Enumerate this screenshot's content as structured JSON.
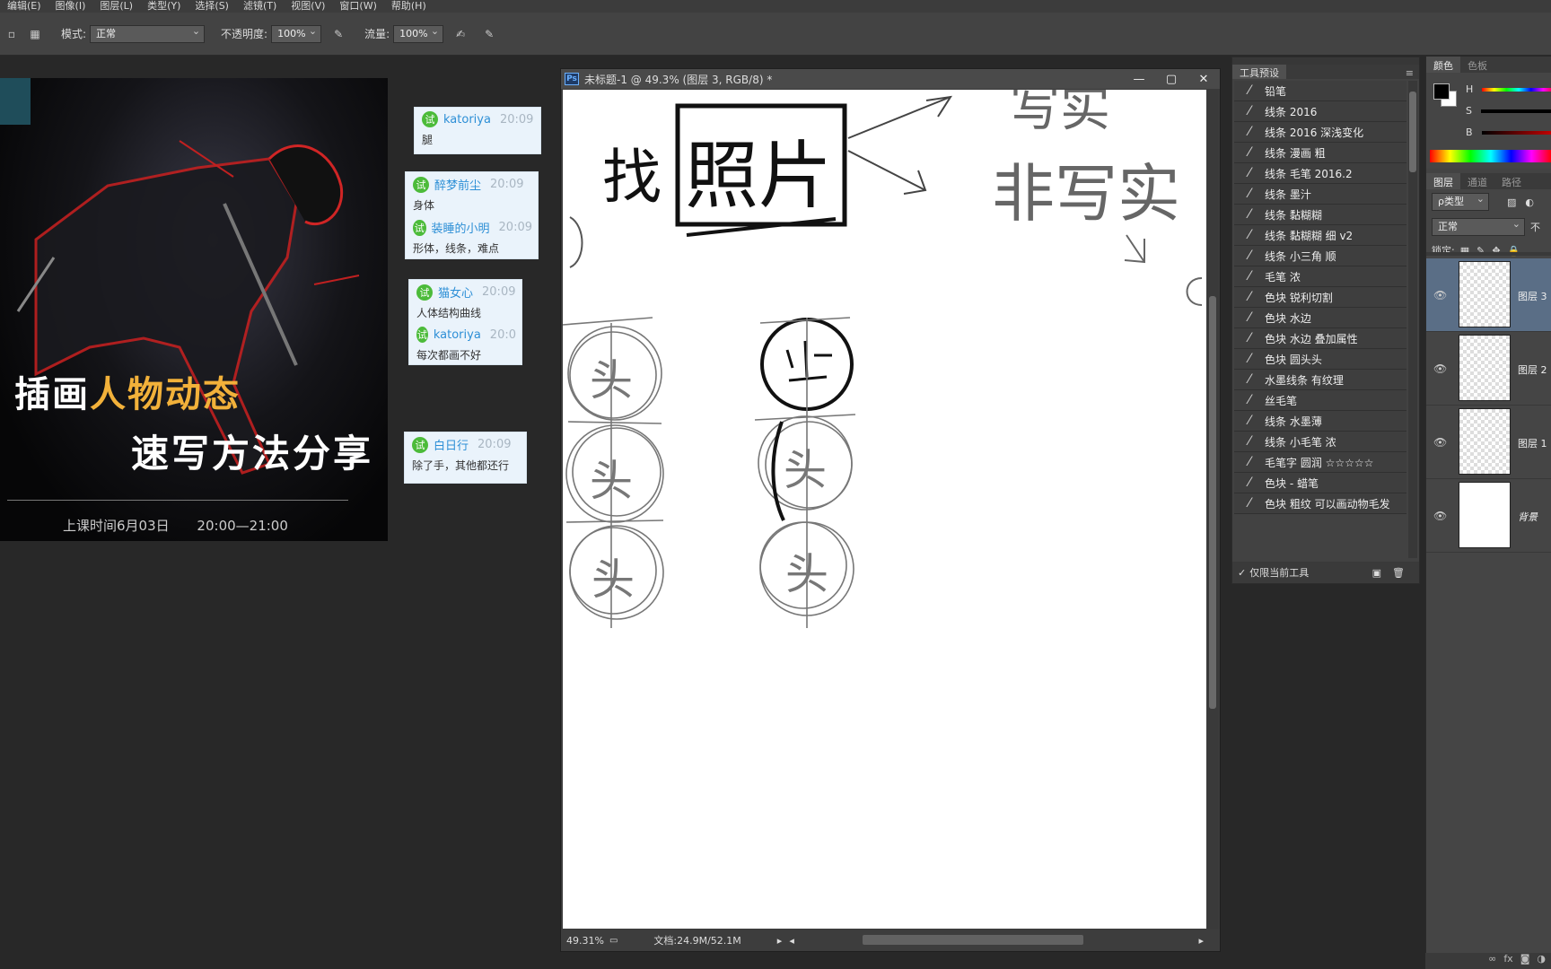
{
  "menu": [
    "编辑(E)",
    "图像(I)",
    "图层(L)",
    "类型(Y)",
    "选择(S)",
    "滤镜(T)",
    "视图(V)",
    "窗口(W)",
    "帮助(H)"
  ],
  "options": {
    "mode_label": "模式:",
    "mode_value": "正常",
    "opacity_label": "不透明度:",
    "opacity_value": "100%",
    "flow_label": "流量:",
    "flow_value": "100%"
  },
  "promo": {
    "title_part1": "插画",
    "title_highlight": "人物动态",
    "title_line2": "速写方法分享",
    "time_date": "上课时间6月03日",
    "time_range": "20:00—21:00"
  },
  "chat": [
    {
      "messages": [
        {
          "badge": "试",
          "name": "katoriya",
          "time": "20:09",
          "text": "腿"
        }
      ]
    },
    {
      "messages": [
        {
          "badge": "试",
          "name": "醉梦前尘",
          "time": "20:09",
          "text": "身体"
        },
        {
          "badge": "试",
          "name": "装睡的小明",
          "time": "20:09",
          "text": "形体，线条，难点"
        }
      ]
    },
    {
      "messages": [
        {
          "badge": "试",
          "name": "猫女心",
          "time": "20:09",
          "text": "人体结构曲线"
        },
        {
          "badge": "试",
          "name": "katoriya",
          "time": "20:0",
          "text": "每次都画不好"
        }
      ]
    },
    {
      "messages": [
        {
          "badge": "试",
          "name": "白日行",
          "time": "20:09",
          "text": "除了手，其他都还行"
        }
      ]
    }
  ],
  "document": {
    "title": "未标题-1 @ 49.3% (图层 3, RGB/8) *",
    "ps_badge": "Ps",
    "zoom": "49.31%",
    "doc_info": "文档:24.9M/52.1M",
    "sketch_text": {
      "find": "找",
      "photo": "照片",
      "realistic": "写实",
      "non_realistic": "非写实",
      "head": "头"
    }
  },
  "presets_panel": {
    "tab": "工具预设",
    "items": [
      "铅笔",
      "线条 2016",
      "线条 2016 深浅变化",
      "线条 漫画 粗",
      "线条 毛笔 2016.2",
      "线条 墨汁",
      "线条 黏糊糊",
      "线条 黏糊糊 细 v2",
      "线条 小三角 顺",
      "毛笔 浓",
      "色块 锐利切割",
      "色块 水边",
      "色块 水边 叠加属性",
      "色块 圆头头",
      "水墨线条 有纹理",
      "丝毛笔",
      "线条 水墨薄",
      "线条 小毛笔 浓",
      "毛笔字 圆润 ☆☆☆☆☆",
      "色块 - 蜡笔",
      "色块 粗纹 可以画动物毛发"
    ],
    "footer_checkbox": "仅限当前工具"
  },
  "color_panel": {
    "tabs": [
      "颜色",
      "色板"
    ],
    "channels": [
      "H",
      "S",
      "B"
    ],
    "fg_color": "#000000",
    "bg_color": "#ffffff"
  },
  "layers_panel": {
    "tabs": [
      "图层",
      "通道",
      "路径"
    ],
    "kind_filter": "ρ类型",
    "blend_mode": "正常",
    "opacity_label": "不",
    "lock_label": "锁定:",
    "layers": [
      {
        "name": "图层 3",
        "active": true
      },
      {
        "name": "图层 2",
        "active": false
      },
      {
        "name": "图层 1",
        "active": false
      },
      {
        "name": "背景",
        "active": false
      }
    ]
  }
}
